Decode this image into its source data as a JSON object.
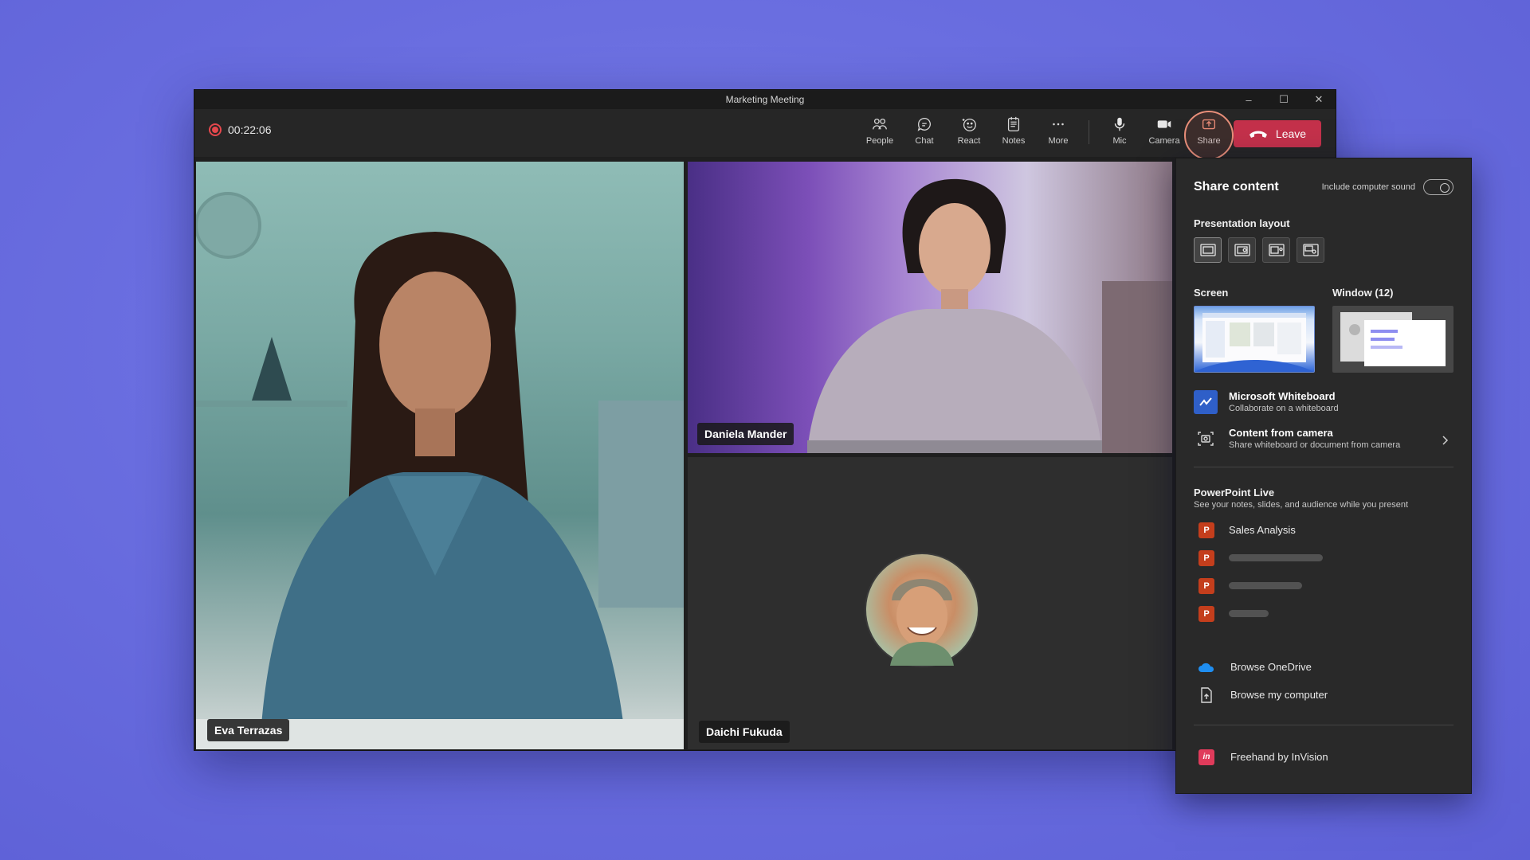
{
  "window": {
    "title": "Marketing Meeting",
    "controls": {
      "minimize": "–",
      "maximize": "☐",
      "close": "✕"
    }
  },
  "toolbar": {
    "timer": "00:22:06",
    "tools": {
      "people": "People",
      "chat": "Chat",
      "react": "React",
      "notes": "Notes",
      "more": "More",
      "mic": "Mic",
      "camera": "Camera",
      "share": "Share"
    },
    "leave_label": "Leave"
  },
  "participants": {
    "eva": "Eva Terrazas",
    "daniela": "Daniela Mander",
    "daichi": "Daichi Fukuda"
  },
  "share_panel": {
    "title": "Share content",
    "include_sound_label": "Include computer sound",
    "presentation_layout_label": "Presentation layout",
    "screen_label": "Screen",
    "window_label": "Window (12)",
    "whiteboard": {
      "title": "Microsoft Whiteboard",
      "subtitle": "Collaborate on a whiteboard"
    },
    "camera_content": {
      "title": "Content from camera",
      "subtitle": "Share whiteboard or document from camera"
    },
    "ppt_live": {
      "title": "PowerPoint Live",
      "subtitle": "See your notes, slides, and audience while you present",
      "files": [
        "Sales Analysis"
      ]
    },
    "browse_onedrive": "Browse OneDrive",
    "browse_computer": "Browse my computer",
    "freehand": "Freehand by InVision"
  },
  "colors": {
    "leave": "#c4314b",
    "accent_ring": "#e98f7a",
    "background": "#6a6ee0",
    "panel": "#292929"
  }
}
